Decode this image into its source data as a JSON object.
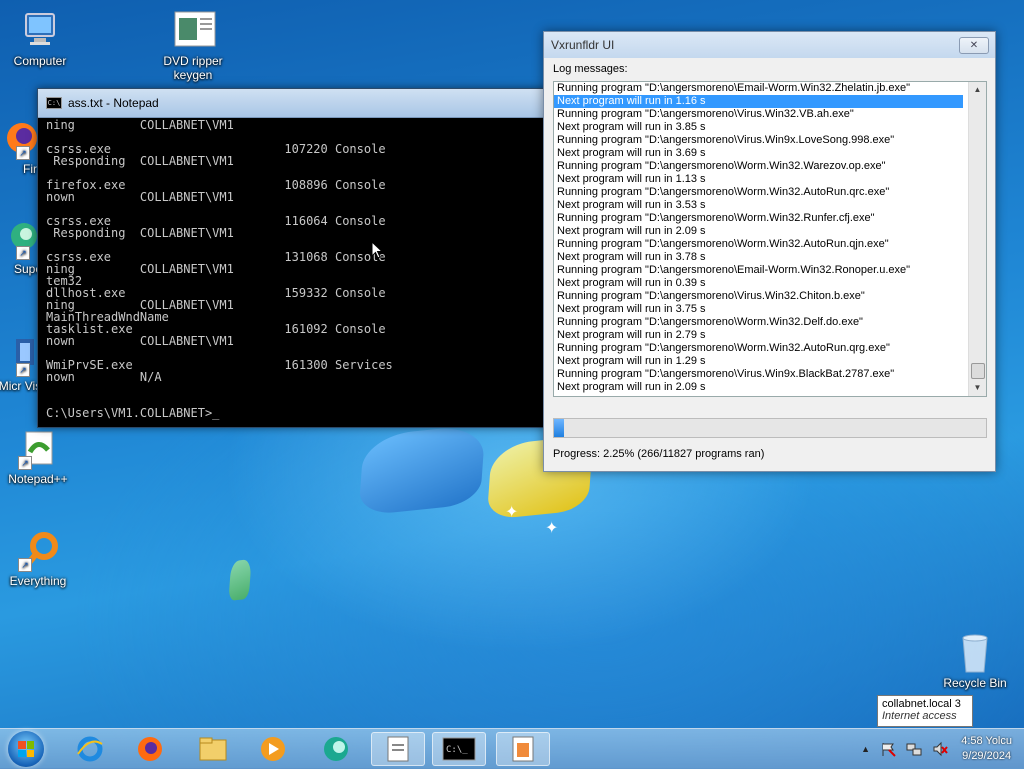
{
  "desktop": {
    "icons": [
      {
        "label": "Computer"
      },
      {
        "label": "DVD ripper keygen"
      },
      {
        "label": "Fir"
      },
      {
        "label": "Super"
      },
      {
        "label": "Micr Visual"
      },
      {
        "label": "Notepad++"
      },
      {
        "label": "Everything"
      },
      {
        "label": "Recycle Bin"
      }
    ]
  },
  "cmd_window": {
    "title": "ass.txt - Notepad",
    "lines": [
      "ning         COLLABNET\\VM1",
      "",
      "csrss.exe                        107220 Console",
      " Responding  COLLABNET\\VM1",
      "",
      "firefox.exe                      108896 Console",
      "nown         COLLABNET\\VM1",
      "",
      "csrss.exe                        116064 Console",
      " Responding  COLLABNET\\VM1",
      "",
      "csrss.exe                        131068 Console",
      "ning         COLLABNET\\VM1",
      "tem32",
      "dllhost.exe                      159332 Console",
      "ning         COLLABNET\\VM1",
      "MainThreadWndName",
      "tasklist.exe                     161092 Console",
      "nown         COLLABNET\\VM1",
      "",
      "WmiPrvSE.exe                     161300 Services",
      "nown         N/A",
      "",
      "",
      "C:\\Users\\VM1.COLLABNET>_"
    ]
  },
  "vx_window": {
    "title": "Vxrunfldr UI",
    "close_label": "✕",
    "log_label": "Log messages:",
    "selected_index": 1,
    "log": [
      "Running program \"D:\\angersmoreno\\Email-Worm.Win32.Zhelatin.jb.exe\"",
      "Next program will run in 1.16 s",
      "Running program \"D:\\angersmoreno\\Virus.Win32.VB.ah.exe\"",
      "Next program will run in 3.85 s",
      "Running program \"D:\\angersmoreno\\Virus.Win9x.LoveSong.998.exe\"",
      "Next program will run in 3.69 s",
      "Running program \"D:\\angersmoreno\\Worm.Win32.Warezov.op.exe\"",
      "Next program will run in 1.13 s",
      "Running program \"D:\\angersmoreno\\Worm.Win32.AutoRun.qrc.exe\"",
      "Next program will run in 3.53 s",
      "Running program \"D:\\angersmoreno\\Worm.Win32.Runfer.cfj.exe\"",
      "Next program will run in 2.09 s",
      "Running program \"D:\\angersmoreno\\Worm.Win32.AutoRun.qjn.exe\"",
      "Next program will run in 3.78 s",
      "Running program \"D:\\angersmoreno\\Email-Worm.Win32.Ronoper.u.exe\"",
      "Next program will run in 0.39 s",
      "Running program \"D:\\angersmoreno\\Virus.Win32.Chiton.b.exe\"",
      "Next program will run in 3.75 s",
      "Running program \"D:\\angersmoreno\\Worm.Win32.Delf.do.exe\"",
      "Next program will run in 2.79 s",
      "Running program \"D:\\angersmoreno\\Worm.Win32.AutoRun.qrg.exe\"",
      "Next program will run in 1.29 s",
      "Running program \"D:\\angersmoreno\\Virus.Win9x.BlackBat.2787.exe\"",
      "Next program will run in 2.09 s"
    ],
    "progress_fraction": 0.0225,
    "progress_text": "Progress: 2.25% (266/11827 programs ran)"
  },
  "tooltip": {
    "line1": "collabnet.local  3",
    "line2": "Internet access"
  },
  "taskbar": {
    "apps": [
      {
        "name": "internet-explorer-icon"
      },
      {
        "name": "firefox-icon"
      },
      {
        "name": "file-explorer-icon"
      },
      {
        "name": "media-player-icon"
      },
      {
        "name": "browser-icon"
      },
      {
        "name": "notepad-icon"
      },
      {
        "name": "command-prompt-icon"
      },
      {
        "name": "app-icon"
      }
    ],
    "tray_up": "▲",
    "clock_time": "4:58 Yolcu",
    "clock_date": "9/29/2024"
  },
  "colors": {
    "selection": "#3399ff",
    "progress": "#1f7fe0"
  }
}
